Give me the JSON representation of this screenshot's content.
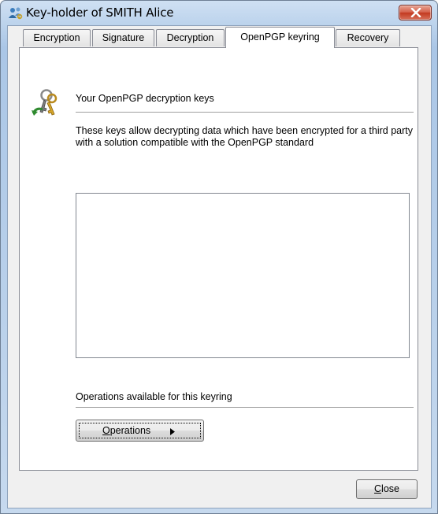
{
  "window": {
    "title": "Key-holder of SMITH Alice"
  },
  "tabs": [
    {
      "label": "Encryption",
      "active": false
    },
    {
      "label": "Signature",
      "active": false
    },
    {
      "label": "Decryption",
      "active": false
    },
    {
      "label": "OpenPGP keyring",
      "active": true
    },
    {
      "label": "Recovery",
      "active": false
    }
  ],
  "panel": {
    "heading": "Your OpenPGP decryption keys",
    "description": "These keys allow decrypting data which have been encrypted for a third party with a solution compatible with the OpenPGP standard",
    "operations_label": "Operations available for this keyring",
    "operations_button_mnemonic": "O",
    "operations_button_rest": "perations"
  },
  "footer": {
    "close_mnemonic": "C",
    "close_rest": "lose"
  },
  "icons": {
    "title": "users-keys-icon",
    "panel": "keys-icon",
    "window_close": "close-icon",
    "operations_arrow": "arrow-right-icon"
  },
  "colors": {
    "close_button": "#c2391f",
    "frame": "#aac6e6",
    "client": "#f0f0f0"
  }
}
